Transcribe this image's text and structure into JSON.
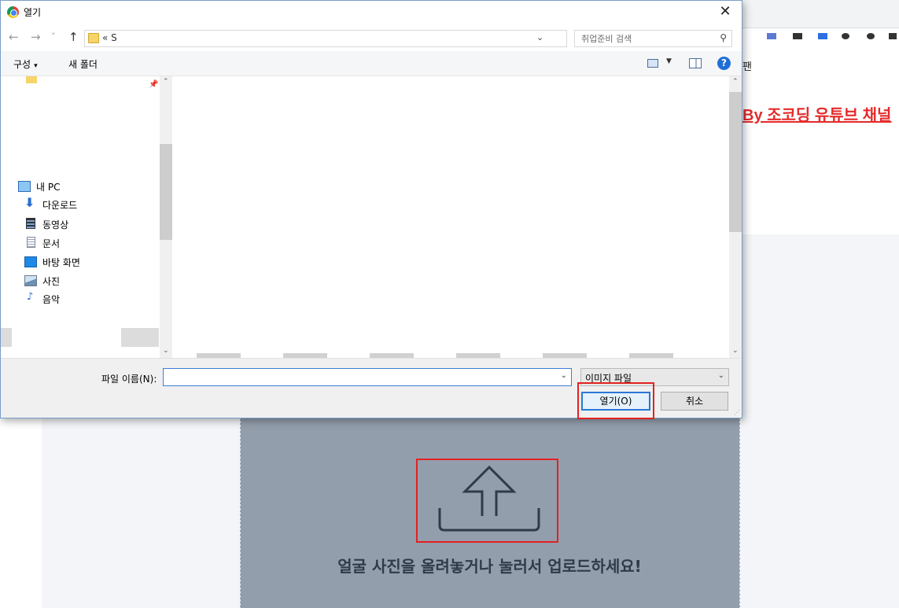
{
  "background_page": {
    "partial_text": "팬",
    "link_text": "By 조코딩 유튜브 채널",
    "upload_text": "얼굴 사진을 올려놓거나 눌러서 업로드하세요!",
    "upload_icon": "upload-icon",
    "colors": {
      "link": "#e52b2b",
      "upload_zone": "#939eac",
      "highlight": "#e32121"
    }
  },
  "dialog": {
    "title": "열기",
    "title_icon": "chrome-icon",
    "close": "✕",
    "nav": {
      "back": "←",
      "forward": "→",
      "recent": "˅",
      "up": "↑",
      "address_crumb": "«  S",
      "search_placeholder": "취업준비 검색"
    },
    "commands": {
      "organize": "구성",
      "organize_caret": "▾",
      "new_folder": "새 폴더",
      "help": "?"
    },
    "sidebar": {
      "items": [
        {
          "label": "내 PC",
          "icon": "computer-icon"
        },
        {
          "label": "다운로드",
          "icon": "download-icon"
        },
        {
          "label": "동영상",
          "icon": "video-icon"
        },
        {
          "label": "문서",
          "icon": "document-icon"
        },
        {
          "label": "바탕 화면",
          "icon": "desktop-icon"
        },
        {
          "label": "사진",
          "icon": "pictures-icon"
        },
        {
          "label": "음악",
          "icon": "music-icon"
        }
      ]
    },
    "footer": {
      "filename_label": "파일 이름(N):",
      "filename_value": "",
      "filetype": "이미지 파일",
      "open_button": "열기(O)",
      "cancel_button": "취소"
    }
  }
}
